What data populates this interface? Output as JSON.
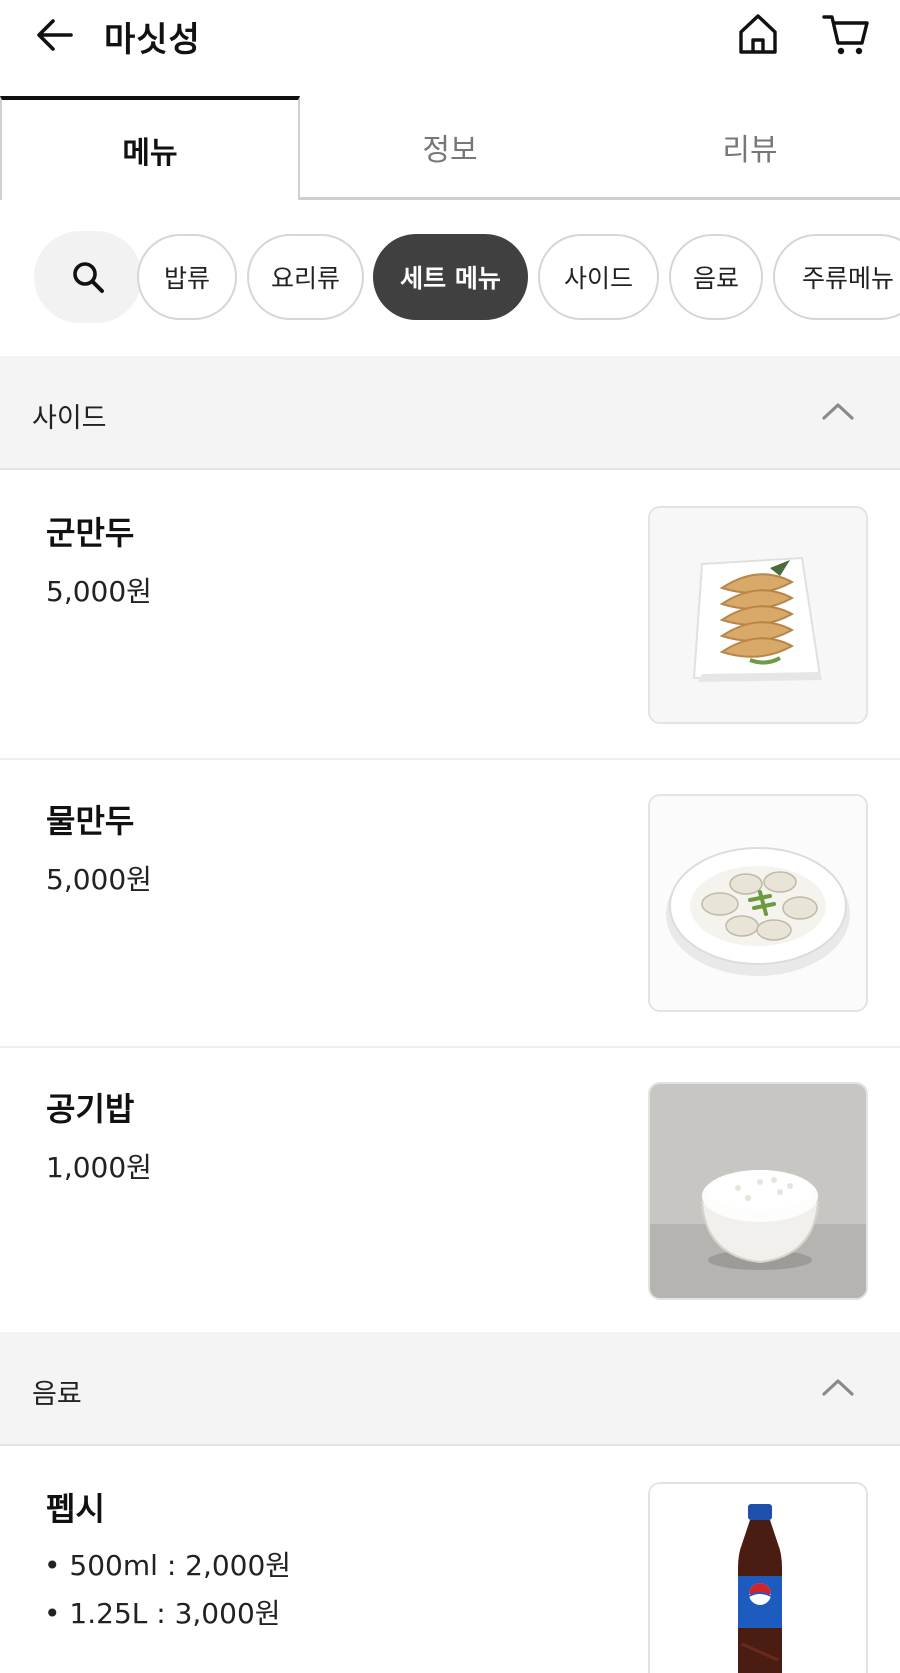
{
  "header": {
    "title": "마싯성",
    "back_icon": "arrow-left-icon",
    "home_icon": "home-icon",
    "cart_icon": "cart-icon"
  },
  "tabs": [
    {
      "label": "메뉴",
      "active": true
    },
    {
      "label": "정보",
      "active": false
    },
    {
      "label": "리뷰",
      "active": false
    }
  ],
  "categories": {
    "search_icon": "search-icon",
    "items": [
      {
        "label": "밥류",
        "selected": false
      },
      {
        "label": "요리류",
        "selected": false
      },
      {
        "label": "세트 메뉴",
        "selected": true
      },
      {
        "label": "사이드",
        "selected": false
      },
      {
        "label": "음료",
        "selected": false
      },
      {
        "label": "주류메뉴",
        "selected": false
      }
    ]
  },
  "sections": [
    {
      "title": "사이드",
      "expanded": true,
      "items": [
        {
          "name": "군만두",
          "price": "5,000원",
          "image": "fried-dumplings-photo"
        },
        {
          "name": "물만두",
          "price": "5,000원",
          "image": "boiled-dumplings-photo"
        },
        {
          "name": "공기밥",
          "price": "1,000원",
          "image": "rice-bowl-photo"
        }
      ]
    },
    {
      "title": "음료",
      "expanded": true,
      "items": [
        {
          "name": "펩시",
          "options": [
            "• 500ml : 2,000원",
            "• 1.25L : 3,000원"
          ],
          "image": "pepsi-bottle-photo"
        }
      ]
    }
  ],
  "colors": {
    "accent_dark": "#404040",
    "section_bg": "#f4f4f4",
    "border": "#d6d6d6"
  }
}
